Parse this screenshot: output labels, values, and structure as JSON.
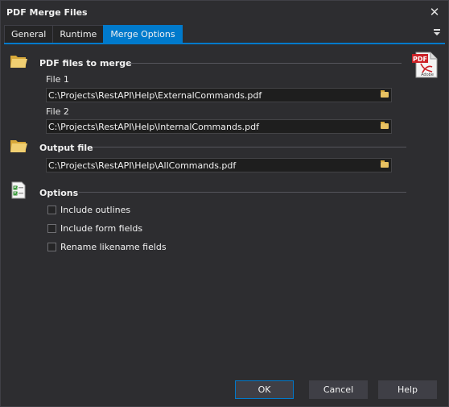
{
  "window": {
    "title": "PDF Merge Files",
    "close_glyph": "✕"
  },
  "tabs": [
    {
      "label": "General"
    },
    {
      "label": "Runtime"
    },
    {
      "label": "Merge Options"
    }
  ],
  "sections": {
    "merge": {
      "title": "PDF files to merge",
      "file1": {
        "label": "File 1",
        "value": "C:\\Projects\\RestAPI\\Help\\ExternalCommands.pdf"
      },
      "file2": {
        "label": "File 2",
        "value": "C:\\Projects\\RestAPI\\Help\\InternalCommands.pdf"
      }
    },
    "output": {
      "title": "Output file",
      "value": "C:\\Projects\\RestAPI\\Help\\AllCommands.pdf"
    },
    "options": {
      "title": "Options",
      "items": [
        {
          "label": "Include outlines",
          "checked": false
        },
        {
          "label": "Include form fields",
          "checked": false
        },
        {
          "label": "Rename likename fields",
          "checked": false
        }
      ]
    }
  },
  "pdf_badge": {
    "top": "PDF",
    "bottom": "Adobe"
  },
  "buttons": {
    "ok": "OK",
    "cancel": "Cancel",
    "help": "Help"
  },
  "colors": {
    "accent": "#007acc",
    "background": "#2d2d30",
    "field_bg": "#1e1e1e"
  },
  "icons": [
    "folder-icon",
    "checklist-icon",
    "pdf-file-icon",
    "browse-folder-icon",
    "close-icon",
    "tab-menu-icon"
  ]
}
